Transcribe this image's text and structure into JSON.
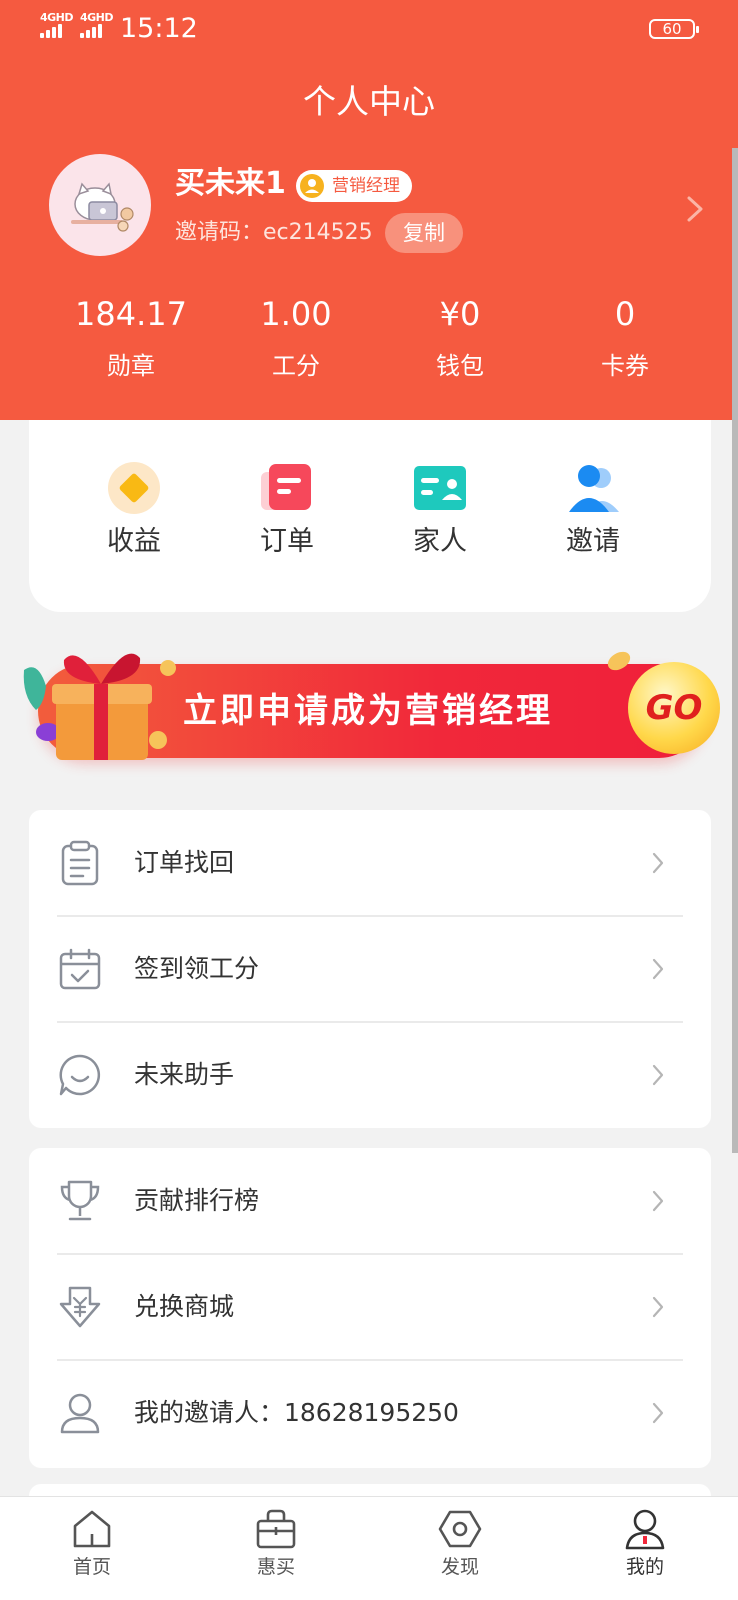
{
  "status_bar": {
    "network_1": "4GHD",
    "network_2": "4GHD",
    "time": "15:12",
    "battery": "60"
  },
  "header": {
    "title": "个人中心",
    "username": "买未来1",
    "role_badge": "营销经理",
    "invite_code_label": "邀请码：ec214525",
    "copy_label": "复制"
  },
  "stats": [
    {
      "value": "184.17",
      "label": "勋章"
    },
    {
      "value": "1.00",
      "label": "工分"
    },
    {
      "value": "¥0",
      "label": "钱包"
    },
    {
      "value": "0",
      "label": "卡券"
    }
  ],
  "quick_actions": [
    {
      "label": "收益",
      "icon": "diamond-icon"
    },
    {
      "label": "订单",
      "icon": "order-icon"
    },
    {
      "label": "家人",
      "icon": "id-card-icon"
    },
    {
      "label": "邀请",
      "icon": "invite-icon"
    }
  ],
  "banner": {
    "text": "立即申请成为营销经理",
    "go_label": "GO"
  },
  "menu_group_1": [
    {
      "label": "订单找回",
      "icon": "clipboard-icon"
    },
    {
      "label": "签到领工分",
      "icon": "calendar-check-icon"
    },
    {
      "label": "未来助手",
      "icon": "chat-bubble-icon"
    }
  ],
  "menu_group_2": [
    {
      "label": "贡献排行榜",
      "icon": "trophy-icon"
    },
    {
      "label": "兑换商城",
      "icon": "yuan-download-icon"
    },
    {
      "label": "我的邀请人：18628195250",
      "icon": "person-icon"
    }
  ],
  "tab_bar": [
    {
      "label": "首页",
      "icon": "home-icon"
    },
    {
      "label": "惠买",
      "icon": "shopping-bag-icon"
    },
    {
      "label": "发现",
      "icon": "discover-icon"
    },
    {
      "label": "我的",
      "icon": "profile-icon",
      "active": true
    }
  ],
  "colors": {
    "brand": "#f55a40",
    "accent_red": "#f1283a",
    "go_yellow": "#ffd84a"
  }
}
